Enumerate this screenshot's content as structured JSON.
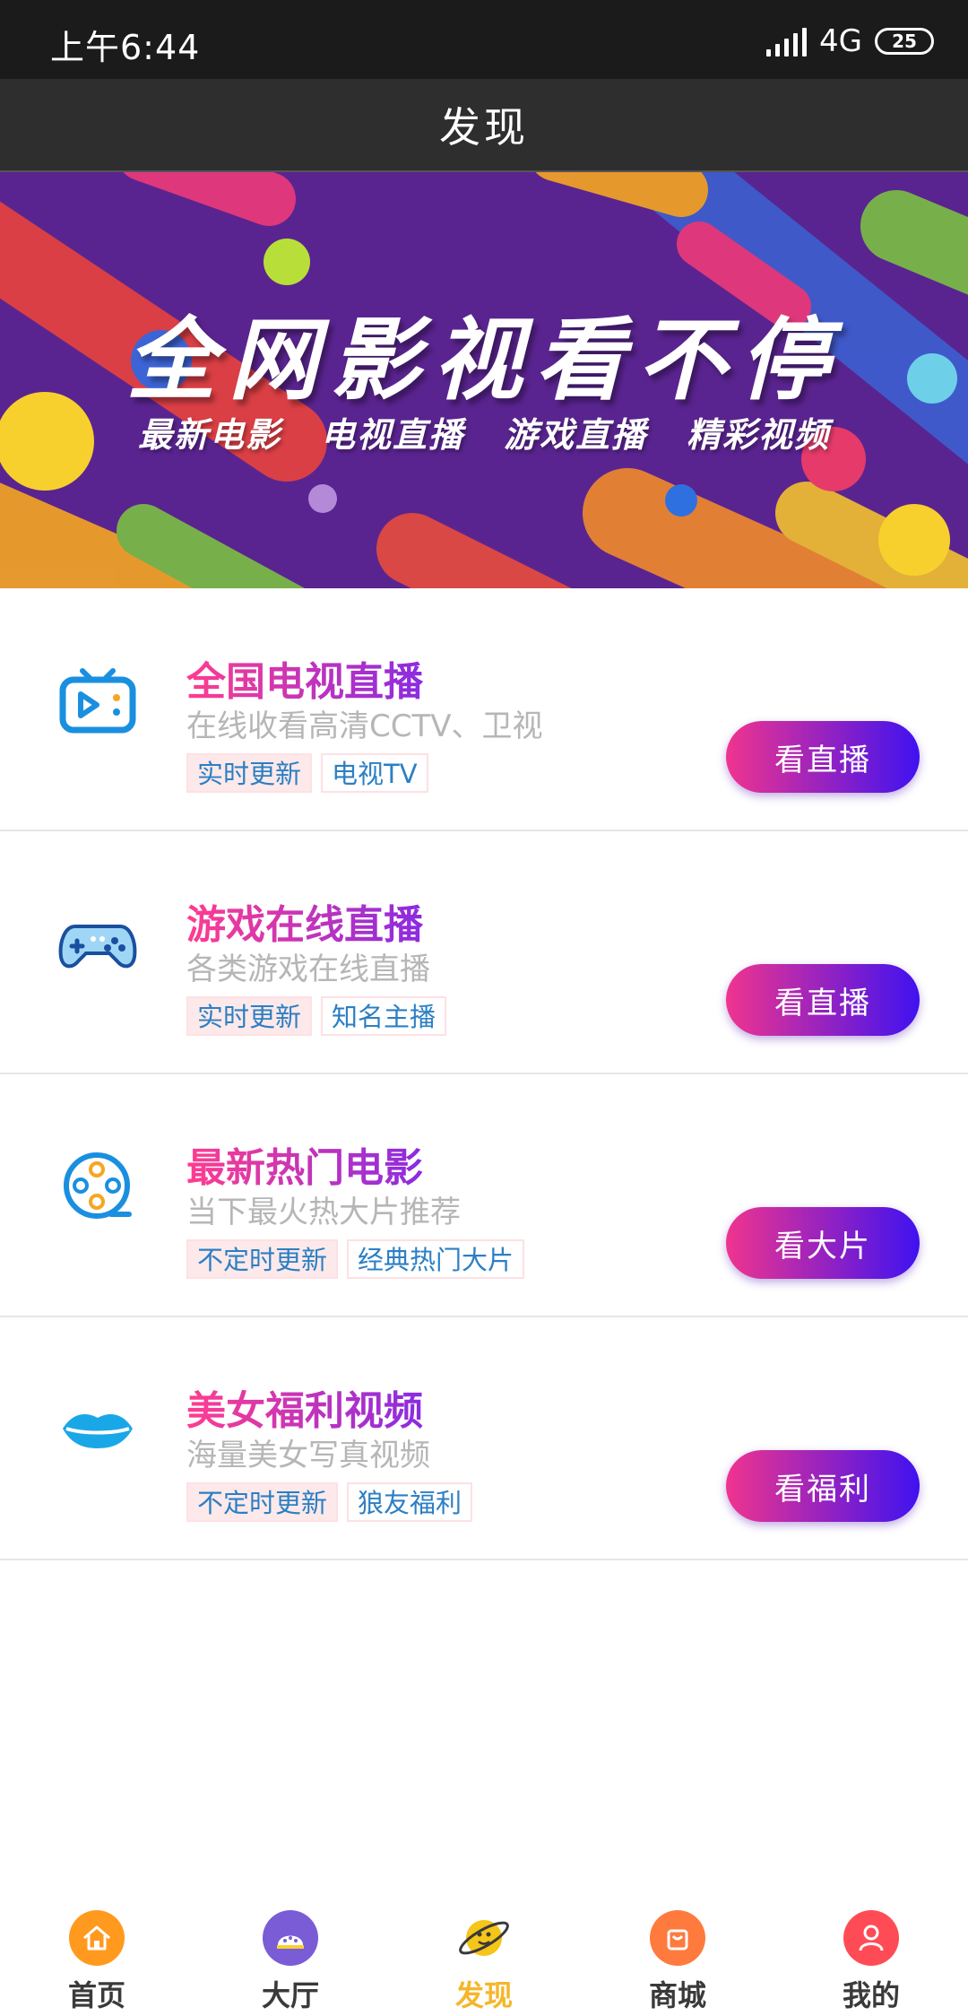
{
  "status_bar": {
    "time": "上午6:44",
    "network": "4G",
    "battery": "25"
  },
  "header": {
    "title": "发现"
  },
  "banner": {
    "title": "全网影视看不停",
    "subtitles": [
      "最新电影",
      "电视直播",
      "游戏直播",
      "精彩视频"
    ]
  },
  "items": [
    {
      "title": "全国电视直播",
      "desc": "在线收看高清CCTV、卫视",
      "tags": [
        "实时更新",
        "电视TV"
      ],
      "button": "看直播",
      "icon": "tv-icon"
    },
    {
      "title": "游戏在线直播",
      "desc": "各类游戏在线直播",
      "tags": [
        "实时更新",
        "知名主播"
      ],
      "button": "看直播",
      "icon": "gamepad-icon"
    },
    {
      "title": "最新热门电影",
      "desc": "当下最火热大片推荐",
      "tags": [
        "不定时更新",
        "经典热门大片"
      ],
      "button": "看大片",
      "icon": "film-reel-icon"
    },
    {
      "title": "美女福利视频",
      "desc": "海量美女写真视频",
      "tags": [
        "不定时更新",
        "狼友福利"
      ],
      "button": "看福利",
      "icon": "lips-icon"
    }
  ],
  "nav": {
    "items": [
      {
        "label": "首页",
        "icon": "home-icon",
        "color": "#ff9a1f"
      },
      {
        "label": "大厅",
        "icon": "hall-icon",
        "color": "#7a5cd6"
      },
      {
        "label": "发现",
        "icon": "planet-icon",
        "color": "#f5c518"
      },
      {
        "label": "商城",
        "icon": "shop-icon",
        "color": "#ff7a3d"
      },
      {
        "label": "我的",
        "icon": "profile-icon",
        "color": "#ff4b55"
      }
    ],
    "active": "发现"
  },
  "colors": {
    "accent_start": "#f0348e",
    "accent_end": "#3f12f0",
    "active_nav": "#f5b62a",
    "tag_text": "#2c7fc4"
  }
}
